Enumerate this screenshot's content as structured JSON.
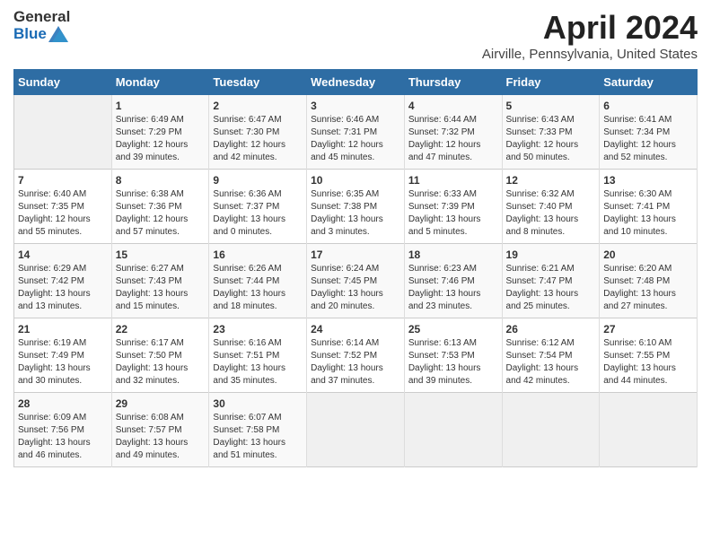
{
  "logo": {
    "general": "General",
    "blue": "Blue"
  },
  "title": "April 2024",
  "location": "Airville, Pennsylvania, United States",
  "days_header": [
    "Sunday",
    "Monday",
    "Tuesday",
    "Wednesday",
    "Thursday",
    "Friday",
    "Saturday"
  ],
  "weeks": [
    [
      {
        "day": "",
        "empty": true
      },
      {
        "day": "1",
        "sunrise": "Sunrise: 6:49 AM",
        "sunset": "Sunset: 7:29 PM",
        "daylight": "Daylight: 12 hours and 39 minutes."
      },
      {
        "day": "2",
        "sunrise": "Sunrise: 6:47 AM",
        "sunset": "Sunset: 7:30 PM",
        "daylight": "Daylight: 12 hours and 42 minutes."
      },
      {
        "day": "3",
        "sunrise": "Sunrise: 6:46 AM",
        "sunset": "Sunset: 7:31 PM",
        "daylight": "Daylight: 12 hours and 45 minutes."
      },
      {
        "day": "4",
        "sunrise": "Sunrise: 6:44 AM",
        "sunset": "Sunset: 7:32 PM",
        "daylight": "Daylight: 12 hours and 47 minutes."
      },
      {
        "day": "5",
        "sunrise": "Sunrise: 6:43 AM",
        "sunset": "Sunset: 7:33 PM",
        "daylight": "Daylight: 12 hours and 50 minutes."
      },
      {
        "day": "6",
        "sunrise": "Sunrise: 6:41 AM",
        "sunset": "Sunset: 7:34 PM",
        "daylight": "Daylight: 12 hours and 52 minutes."
      }
    ],
    [
      {
        "day": "7",
        "sunrise": "Sunrise: 6:40 AM",
        "sunset": "Sunset: 7:35 PM",
        "daylight": "Daylight: 12 hours and 55 minutes."
      },
      {
        "day": "8",
        "sunrise": "Sunrise: 6:38 AM",
        "sunset": "Sunset: 7:36 PM",
        "daylight": "Daylight: 12 hours and 57 minutes."
      },
      {
        "day": "9",
        "sunrise": "Sunrise: 6:36 AM",
        "sunset": "Sunset: 7:37 PM",
        "daylight": "Daylight: 13 hours and 0 minutes."
      },
      {
        "day": "10",
        "sunrise": "Sunrise: 6:35 AM",
        "sunset": "Sunset: 7:38 PM",
        "daylight": "Daylight: 13 hours and 3 minutes."
      },
      {
        "day": "11",
        "sunrise": "Sunrise: 6:33 AM",
        "sunset": "Sunset: 7:39 PM",
        "daylight": "Daylight: 13 hours and 5 minutes."
      },
      {
        "day": "12",
        "sunrise": "Sunrise: 6:32 AM",
        "sunset": "Sunset: 7:40 PM",
        "daylight": "Daylight: 13 hours and 8 minutes."
      },
      {
        "day": "13",
        "sunrise": "Sunrise: 6:30 AM",
        "sunset": "Sunset: 7:41 PM",
        "daylight": "Daylight: 13 hours and 10 minutes."
      }
    ],
    [
      {
        "day": "14",
        "sunrise": "Sunrise: 6:29 AM",
        "sunset": "Sunset: 7:42 PM",
        "daylight": "Daylight: 13 hours and 13 minutes."
      },
      {
        "day": "15",
        "sunrise": "Sunrise: 6:27 AM",
        "sunset": "Sunset: 7:43 PM",
        "daylight": "Daylight: 13 hours and 15 minutes."
      },
      {
        "day": "16",
        "sunrise": "Sunrise: 6:26 AM",
        "sunset": "Sunset: 7:44 PM",
        "daylight": "Daylight: 13 hours and 18 minutes."
      },
      {
        "day": "17",
        "sunrise": "Sunrise: 6:24 AM",
        "sunset": "Sunset: 7:45 PM",
        "daylight": "Daylight: 13 hours and 20 minutes."
      },
      {
        "day": "18",
        "sunrise": "Sunrise: 6:23 AM",
        "sunset": "Sunset: 7:46 PM",
        "daylight": "Daylight: 13 hours and 23 minutes."
      },
      {
        "day": "19",
        "sunrise": "Sunrise: 6:21 AM",
        "sunset": "Sunset: 7:47 PM",
        "daylight": "Daylight: 13 hours and 25 minutes."
      },
      {
        "day": "20",
        "sunrise": "Sunrise: 6:20 AM",
        "sunset": "Sunset: 7:48 PM",
        "daylight": "Daylight: 13 hours and 27 minutes."
      }
    ],
    [
      {
        "day": "21",
        "sunrise": "Sunrise: 6:19 AM",
        "sunset": "Sunset: 7:49 PM",
        "daylight": "Daylight: 13 hours and 30 minutes."
      },
      {
        "day": "22",
        "sunrise": "Sunrise: 6:17 AM",
        "sunset": "Sunset: 7:50 PM",
        "daylight": "Daylight: 13 hours and 32 minutes."
      },
      {
        "day": "23",
        "sunrise": "Sunrise: 6:16 AM",
        "sunset": "Sunset: 7:51 PM",
        "daylight": "Daylight: 13 hours and 35 minutes."
      },
      {
        "day": "24",
        "sunrise": "Sunrise: 6:14 AM",
        "sunset": "Sunset: 7:52 PM",
        "daylight": "Daylight: 13 hours and 37 minutes."
      },
      {
        "day": "25",
        "sunrise": "Sunrise: 6:13 AM",
        "sunset": "Sunset: 7:53 PM",
        "daylight": "Daylight: 13 hours and 39 minutes."
      },
      {
        "day": "26",
        "sunrise": "Sunrise: 6:12 AM",
        "sunset": "Sunset: 7:54 PM",
        "daylight": "Daylight: 13 hours and 42 minutes."
      },
      {
        "day": "27",
        "sunrise": "Sunrise: 6:10 AM",
        "sunset": "Sunset: 7:55 PM",
        "daylight": "Daylight: 13 hours and 44 minutes."
      }
    ],
    [
      {
        "day": "28",
        "sunrise": "Sunrise: 6:09 AM",
        "sunset": "Sunset: 7:56 PM",
        "daylight": "Daylight: 13 hours and 46 minutes."
      },
      {
        "day": "29",
        "sunrise": "Sunrise: 6:08 AM",
        "sunset": "Sunset: 7:57 PM",
        "daylight": "Daylight: 13 hours and 49 minutes."
      },
      {
        "day": "30",
        "sunrise": "Sunrise: 6:07 AM",
        "sunset": "Sunset: 7:58 PM",
        "daylight": "Daylight: 13 hours and 51 minutes."
      },
      {
        "day": "",
        "empty": true
      },
      {
        "day": "",
        "empty": true
      },
      {
        "day": "",
        "empty": true
      },
      {
        "day": "",
        "empty": true
      }
    ]
  ]
}
